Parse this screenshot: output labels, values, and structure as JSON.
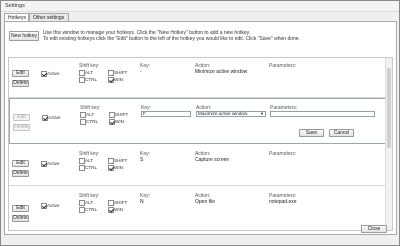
{
  "window": {
    "title": "Settings"
  },
  "tabs": [
    {
      "label": "Hotkeys"
    },
    {
      "label": "Other settings"
    }
  ],
  "toolbar": {
    "new_hotkey_label": "New hotkey",
    "info_line1": "Use this window to manage your hotkeys. Click the \"New Hotkey\" button to add a new hotkey.",
    "info_line2": "To edit existing hotkeys click the \"Edit\" button to the left of the hotkey you would like to edit. Click \"Save\" when done."
  },
  "labels": {
    "edit": "Edit",
    "delete": "Delete",
    "active": "Active",
    "shift_key": "Shift key:",
    "key": "Key:",
    "action": "Action:",
    "parameters": "Parameters:",
    "alt": "ALT",
    "ctrl": "CTRL",
    "shift": "SHIFT",
    "win": "WIN",
    "save": "Save",
    "cancel": "Cancel"
  },
  "hotkeys": [
    {
      "key": "-",
      "action": "Minimize active window",
      "parameters": ""
    },
    {
      "key": "F",
      "action": "Maximize active window",
      "parameters": ""
    },
    {
      "key": "S",
      "action": "Capture screen",
      "parameters": ""
    },
    {
      "key": "N",
      "action": "Open file",
      "parameters": "notepad.exe"
    }
  ],
  "footer": {
    "close_label": "Close"
  }
}
